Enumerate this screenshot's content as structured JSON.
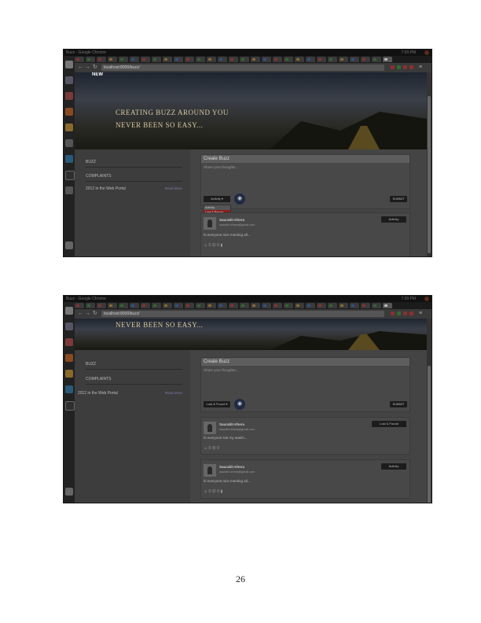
{
  "page": {
    "number": "26"
  },
  "screenshots": [
    {
      "window_title": "Buzz - Google Chrome",
      "clock": "7:09 PM",
      "url": "localhost:8000/buzz/",
      "banner": {
        "logo": "NEW",
        "line1": "CREATING BUZZ AROUND YOU",
        "line2": "NEVER BEEN SO EASY..."
      },
      "sidebar": {
        "item1": "BUZZ",
        "item2": "COMPLAINTS",
        "post_title": "2012 in the Web Portal",
        "post_link": "Read More"
      },
      "create": {
        "header": "Create Buzz",
        "placeholder": "Share your thoughts...",
        "category_value": "Activity",
        "dropdown_options": [
          "Activity",
          "Lost & Found"
        ],
        "submit": "SUBMIT"
      },
      "posts": [
        {
          "name": "Saurabh Khera",
          "email": "saurabh.khera@gmail.com",
          "text": "hi everyone nice meeting all...",
          "tag": "Activity",
          "likes": "0",
          "dislikes": "0"
        }
      ]
    },
    {
      "window_title": "Buzz - Google Chrome",
      "clock": "7:09 PM",
      "url": "localhost:8000/buzz/",
      "banner": {
        "line2": "NEVER BEEN SO EASY..."
      },
      "sidebar": {
        "item1": "BUZZ",
        "item2": "COMPLAINTS",
        "post_title": "2012 in the Web Portal",
        "post_link": "Read More"
      },
      "create": {
        "header": "Create Buzz",
        "placeholder": "Share your thoughts...",
        "category_value": "Lost & Found",
        "submit": "SUBMIT"
      },
      "posts": [
        {
          "name": "Saurabh Khera",
          "email": "saurabh.khera@gmail.com",
          "text": "hi everyone lost my watch...",
          "tag": "Lost & Found",
          "likes": "0",
          "dislikes": "0"
        },
        {
          "name": "Saurabh Khera",
          "email": "saurabh.khera@gmail.com",
          "text": "hi everyone nice meeting all...",
          "tag": "Activity",
          "likes": "0",
          "dislikes": "0"
        }
      ]
    }
  ]
}
